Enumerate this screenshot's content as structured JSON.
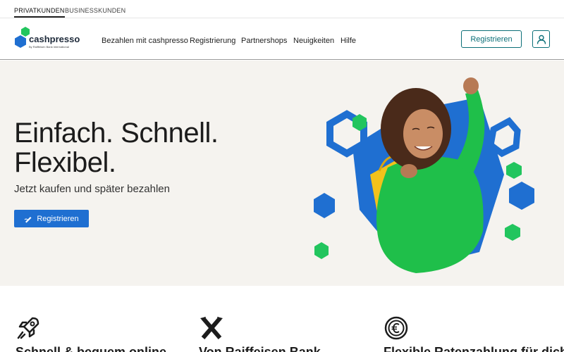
{
  "segments": [
    {
      "label": "PRIVATKUNDEN",
      "active": true
    },
    {
      "label": "BUSINESSKUNDEN",
      "active": false
    }
  ],
  "brand": {
    "name": "cashpresso",
    "tagline": "By Raiffeisen Bank International",
    "colors": {
      "blue": "#1f6fd1",
      "green": "#22c55e",
      "teal": "#0b6f78"
    }
  },
  "nav": {
    "items": [
      "Bezahlen mit cashpresso",
      "Registrierung",
      "Partnershops",
      "Neuigkeiten",
      "Hilfe"
    ],
    "register_label": "Registrieren",
    "user_icon": "user-icon"
  },
  "hero": {
    "title_lines": [
      "Einfach. Schnell.",
      "Flexibel."
    ],
    "subtitle": "Jetzt kaufen und später bezahlen",
    "cta_label": "Registrieren",
    "cta_icon": "signature-pen-icon"
  },
  "features": [
    {
      "icon": "rocket-icon",
      "title": "Schnell & bequem online"
    },
    {
      "icon": "raiffeisen-icon",
      "title": "Von Raiffeisen Bank"
    },
    {
      "icon": "euro-icon",
      "title": "Flexible Ratenzahlung für dich"
    }
  ]
}
